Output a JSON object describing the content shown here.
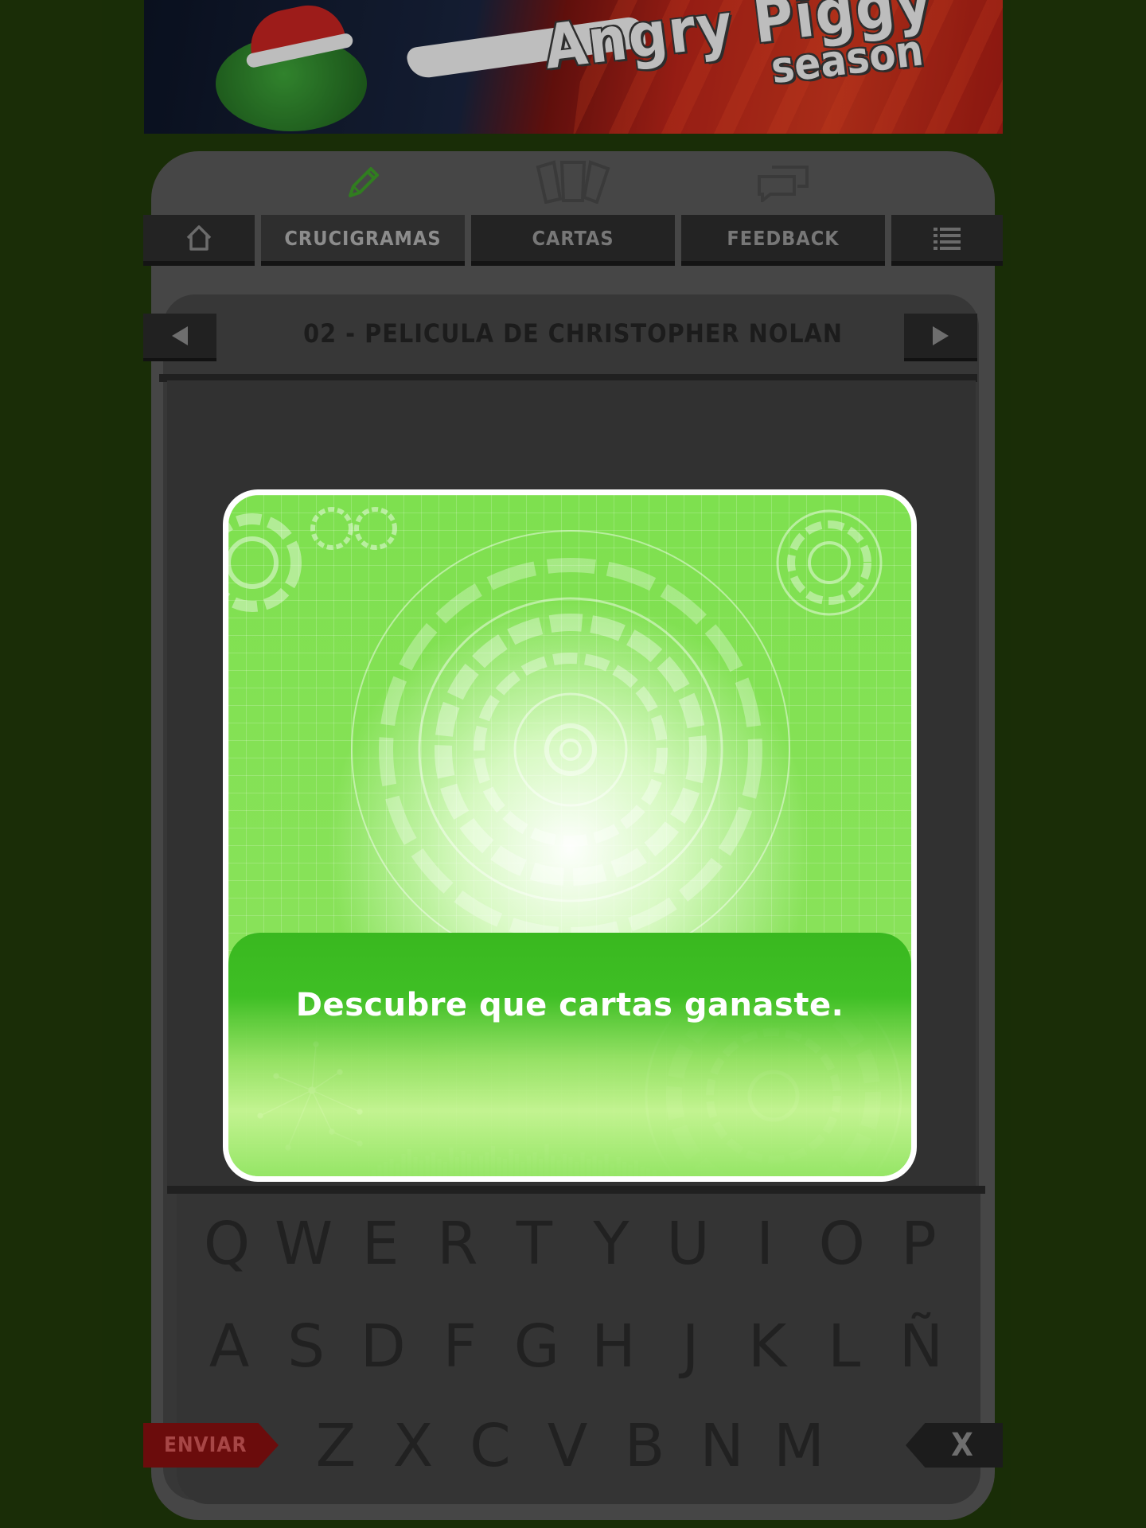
{
  "banner": {
    "title_line1": "Angry Piggy",
    "title_line2": "season"
  },
  "nav": {
    "tabs": [
      "CRUCIGRAMAS",
      "CARTAS",
      "FEEDBACK"
    ],
    "active_tab": "CRUCIGRAMAS",
    "active_color": "#3fa02a"
  },
  "puzzle": {
    "title": "02 - PELICULA DE CHRISTOPHER NOLAN"
  },
  "keyboard": {
    "row1": [
      "Q",
      "W",
      "E",
      "R",
      "T",
      "Y",
      "U",
      "I",
      "O",
      "P"
    ],
    "row2": [
      "A",
      "S",
      "D",
      "F",
      "G",
      "H",
      "J",
      "K",
      "L",
      "Ñ"
    ],
    "row3": [
      "Z",
      "X",
      "C",
      "V",
      "B",
      "N",
      "M"
    ],
    "submit_label": "ENVIAR",
    "clear_label": "X"
  },
  "modal": {
    "message": "Descubre que cartas ganaste."
  },
  "colors": {
    "background": "#213a09",
    "modal_green": "#3fbf25",
    "submit_red": "#8a1010"
  }
}
